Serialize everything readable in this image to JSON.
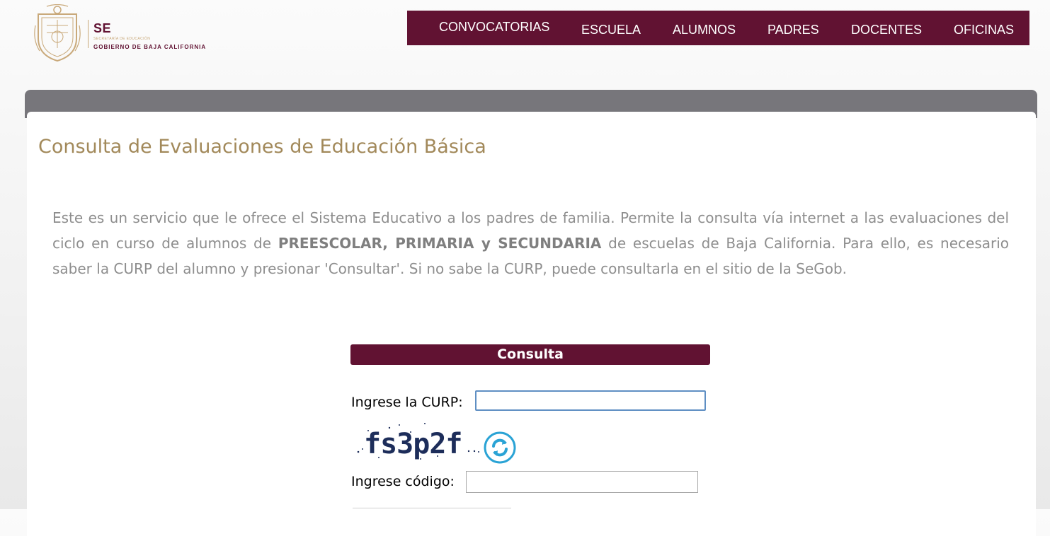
{
  "logo": {
    "abbr": "SE",
    "subtitle": "SECRETARÍA DE EDUCACIÓN",
    "government": "GOBIERNO DE BAJA CALIFORNIA",
    "icon": "state-seal-icon"
  },
  "nav": {
    "items": [
      {
        "label": "CONVOCATORIAS"
      },
      {
        "label": "ESCUELA"
      },
      {
        "label": "ALUMNOS"
      },
      {
        "label": "PADRES"
      },
      {
        "label": "DOCENTES"
      },
      {
        "label": "OFICINAS"
      }
    ]
  },
  "main": {
    "title": "Consulta de Evaluaciones de Educación Básica",
    "intro": {
      "part1": "Este es un servicio que le ofrece el Sistema Educativo a los padres de familia. Permite la consulta vía internet a las evaluaciones del ciclo en curso de alumnos de ",
      "levels": "PREESCOLAR, PRIMARIA y SECUNDARIA",
      "part2": " de escuelas de Baja California. Para ello, es necesario saber la CURP del alumno y presionar 'Consultar'. Si no sabe la CURP, puede consultarla en el sitio de la SeGob."
    }
  },
  "form": {
    "header": "Consulta",
    "curp_label": "Ingrese la CURP:",
    "curp_value": "",
    "captcha_text": "fs3p2f",
    "refresh_icon": "refresh-icon",
    "code_label": "Ingrese código:",
    "code_value": ""
  },
  "colors": {
    "brand": "#611232",
    "gold": "#a2895a",
    "panel_bar": "#77767b",
    "body_text": "#8e8e8e",
    "refresh": "#2aa3d5"
  }
}
